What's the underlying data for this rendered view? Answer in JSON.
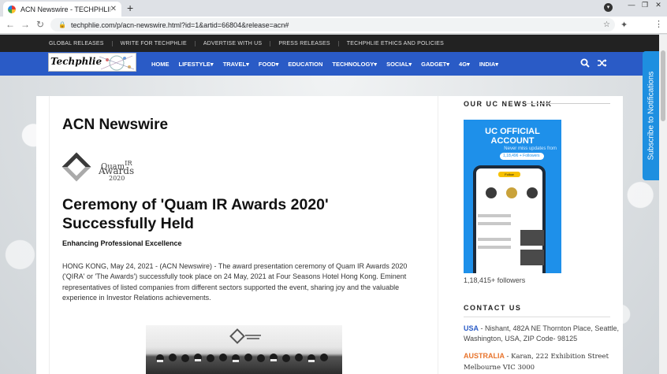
{
  "browser": {
    "tab_title": "ACN Newswire - TECHPHLIE",
    "new_tab": "+",
    "close_tab": "✕",
    "url": "techphlie.com/p/acn-newswire.html?id=1&artid=66804&release=acn#",
    "nav": {
      "back": "←",
      "forward": "→",
      "reload": "↻"
    },
    "window": {
      "min": "—",
      "max": "❐",
      "close": "✕"
    }
  },
  "topbar": {
    "links": [
      "GLOBAL RELEASES",
      "WRITE FOR TECHPHLIE",
      "ADVERTISE WITH US",
      "PRESS RELEASES",
      "TECHPHLIE ETHICS AND POLICIES"
    ]
  },
  "site": {
    "logo_text": "Techphlie",
    "menu": [
      "HOME",
      "LIFESTYLE▾",
      "TRAVEL▾",
      "FOOD▾",
      "EDUCATION",
      "TECHNOLOGY▾",
      "SOCIAL▾",
      "GADGET▾",
      "4G▾",
      "INDIA▾"
    ]
  },
  "article": {
    "page_title": "ACN Newswire",
    "logo": {
      "line1": "Quam",
      "line1_sup": "IR",
      "line2": "Awards",
      "line3": "2020"
    },
    "headline": "Ceremony of 'Quam IR Awards 2020' Successfully Held",
    "subhead": "Enhancing Professional Excellence",
    "body": "HONG KONG, May 24, 2021 - (ACN Newswire) - The award presentation ceremony of Quam IR Awards 2020 ('QIRA' or 'The Awards') successfully took place on 24 May, 2021 at Four Seasons Hotel Hong Kong. Eminent representatives of listed companies from different sectors supported the event, sharing joy and the valuable experience in Investor Relations achievements."
  },
  "sidebar": {
    "uc_heading": "OUR UC NEWS LINK",
    "uc_image": {
      "title_l1": "UC OFFICIAL",
      "title_l2": "ACCOUNT",
      "tagline": "Never miss updates from",
      "followers_pill": "1,18,496 +  Followers",
      "follow_btn": "Follow"
    },
    "followers": "1,18,415+ followers",
    "contact_heading": "CONTACT US",
    "usa_label": "USA",
    "usa_text": " - Nishant, 482A NE Thornton Place, Seattle, Washington, USA, ZIP Code- 98125",
    "aus_label": "AUSTRALIA",
    "aus_text": "- Karan, 222 Exhibition Street Melbourne VIC 3000"
  },
  "subscribe_label": "Subscribe to Notifications",
  "colors": {
    "nav_blue": "#2a5bc6",
    "topbar": "#222222",
    "subscribe": "#1e8fe0",
    "usa": "#2a5bc6",
    "australia": "#e8742c"
  }
}
